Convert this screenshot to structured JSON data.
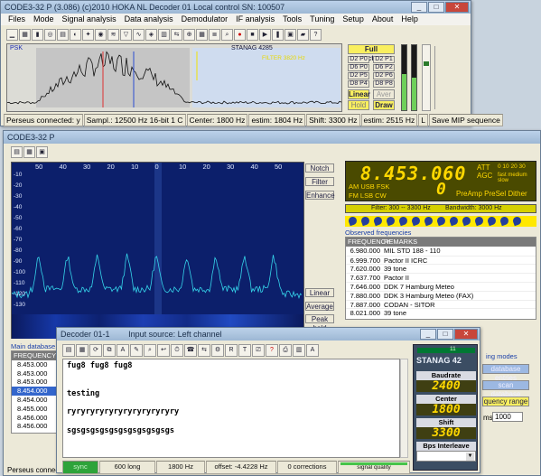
{
  "top_window": {
    "title": "CODE3-32 P (3.086) (c)2010 HOKA NL    Decoder 01    Local control    SN: 100507",
    "menu": [
      "Files",
      "Mode",
      "Signal analysis",
      "Data analysis",
      "Demodulator",
      "IF analysis",
      "Tools",
      "Tuning",
      "Setup",
      "About",
      "Help"
    ],
    "spectrum": {
      "left_label": "PSK",
      "center_label": "STANAG 4285",
      "filter_label": "FILTER 3820 Hz"
    },
    "right_buttons": {
      "full": "Full spectrum",
      "grid": [
        [
          "D2 P0",
          "D2 P1"
        ],
        [
          "D6 P0",
          "D6 P2"
        ],
        [
          "D2 P5",
          "D2 P6"
        ],
        [
          "D8 P4",
          "D8 P8"
        ]
      ],
      "linear": "Linear",
      "aver": "Aver",
      "hold": "Hold",
      "draw": "Draw"
    },
    "status": [
      "Perseus connected: y",
      "Sampl.: 12500 Hz 16-bit 1 C",
      "Center: 1800 Hz",
      "estim: 1804 Hz",
      "Shift: 3300 Hz",
      "estim: 2515 Hz",
      "L",
      "Save MIP sequence"
    ]
  },
  "main_window": {
    "title": "CODE3-32 P",
    "scale": [
      "50",
      "40",
      "30",
      "20",
      "10",
      "0",
      "10",
      "20",
      "30",
      "40",
      "50"
    ],
    "db_labels": [
      "-10",
      "-20",
      "-30",
      "-40",
      "-50",
      "-60",
      "-70",
      "-80",
      "-90",
      "-100",
      "-110",
      "-120",
      "-130"
    ],
    "side_buttons": {
      "notch": "Notch",
      "filter": "Filter",
      "enhance": "Enhance",
      "linear": "Linear",
      "average": "Average",
      "peak": "Peak hold"
    },
    "lcd": {
      "freq": "8.453.060",
      "sub": "0",
      "att": "ATT",
      "agc": "AGC",
      "modes_top": "AM USB FSK",
      "modes_bot": "FM LSB CW",
      "range": "0 10 20 30",
      "speeds": "fast medium slow",
      "flags": "PreAmp PreSel Dither"
    },
    "filter_bar": {
      "filter": "Filter: 300 -- 3300 Hz",
      "bandwidth": "Bandwidth: 3000 Hz"
    },
    "observed": {
      "title": "Observed frequencies",
      "headers": [
        "FREQUENCY",
        "REMARKS"
      ],
      "rows": [
        [
          "6.980.000",
          "MIL STD 188 - 110"
        ],
        [
          "6.999.700",
          "Pactor II ICRC"
        ],
        [
          "7.620.000",
          "39 tone"
        ],
        [
          "7.637.700",
          "Pactor II"
        ],
        [
          "7.646.000",
          "DDK 7 Hamburg Meteo"
        ],
        [
          "7.880.000",
          "DDK 3 Hamburg Meteo (FAX)"
        ],
        [
          "7.887.000",
          "CODAN - SITOR"
        ],
        [
          "8.021.000",
          "39 tone"
        ]
      ]
    },
    "main_db": {
      "title": "Main database",
      "header": "FREQUENCY",
      "rows": [
        "8.453.000",
        "8.453.000",
        "8.453.000",
        "8.454.000",
        "8.454.000",
        "8.455.000",
        "8.456.000",
        "8.456.000"
      ]
    },
    "right_extra": {
      "modes": "ing modes",
      "db_entries": "database entries",
      "scan": "scan database",
      "range": "quency range",
      "khz": "ms]",
      "khz_val": "1000"
    },
    "status": "Perseus connect"
  },
  "decoder": {
    "title": "Decoder 01-1",
    "input_source": "Input source: Left channel",
    "lines": [
      "fug8 fug8 fug8",
      "",
      "",
      "testing",
      "",
      "ryryryryryryryryryryryry",
      "",
      "sgsgsgsgsgsgsgsgsgsgsgs"
    ],
    "side": {
      "counter": "11",
      "mode": "STANAG 42",
      "baudrate_label": "Baudrate",
      "baudrate": "2400",
      "center_label": "Center",
      "center": "1800",
      "shift_label": "Shift",
      "shift": "3300",
      "bps_label": "Bps Interleave",
      "bps": ""
    },
    "status": {
      "sync": "sync",
      "long": "600 long",
      "hz": "1800 Hz",
      "offset": "offset: -4.4228 Hz",
      "corrections": "0 corrections",
      "quality": "signal quality"
    }
  }
}
